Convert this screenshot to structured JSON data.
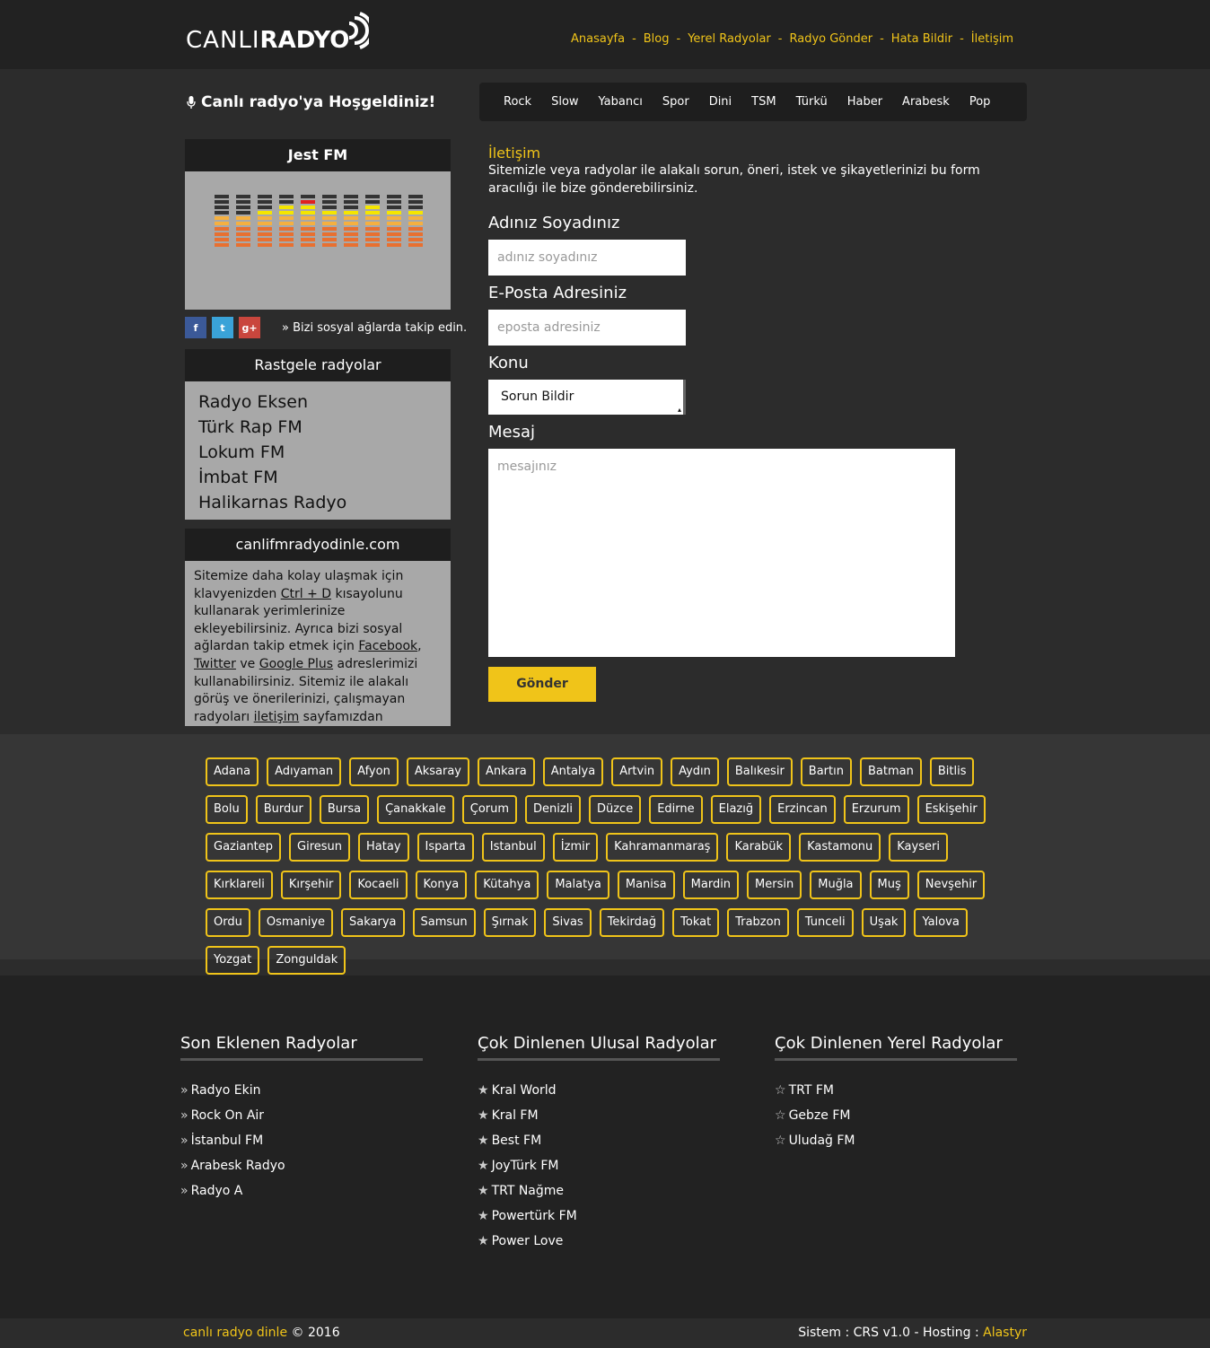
{
  "logo": {
    "part1": "CANLI",
    "part2": "RADYO"
  },
  "nav": [
    "Anasayfa",
    "Blog",
    "Yerel Radyolar",
    "Radyo Gönder",
    "Hata Bildir",
    "İletişim"
  ],
  "welcome": "Canlı radyo'ya Hoşgeldiniz!",
  "genres": [
    "Rock",
    "Slow",
    "Yabancı",
    "Spor",
    "Dini",
    "TSM",
    "Türkü",
    "Haber",
    "Arabesk",
    "Pop"
  ],
  "player": {
    "title": "Jest FM",
    "levels": [
      0.55,
      0.55,
      0.65,
      0.75,
      0.9,
      0.65,
      0.65,
      0.8,
      0.65,
      0.65
    ]
  },
  "social": {
    "facebook": "f",
    "twitter": "t",
    "gplus": "g+",
    "text": "Bizi sosyal ağlarda takip edin."
  },
  "random": {
    "title": "Rastgele radyolar",
    "items": [
      "Radyo Eksen",
      "Türk Rap FM",
      "Lokum FM",
      "İmbat FM",
      "Halikarnas Radyo"
    ]
  },
  "info": {
    "title": "canlifmradyodinle.com",
    "t1": "Sitemize daha kolay ulaşmak için klavyenizden ",
    "k1": "Ctrl + D",
    "t2": " kısayolunu kullanarak yerimlerinize ekleyebilirsiniz. Ayrıca bizi sosyal ağlardan takip etmek için ",
    "l1": "Facebook",
    "t3": ", ",
    "l2": "Twitter",
    "t4": " ve ",
    "l3": "Google Plus",
    "t5": " adreslerimizi kullanabilirsiniz. Sitemiz ile alakalı görüş ve önerilerinizi, çalışmayan radyoları ",
    "l4": "iletişim",
    "t6": " sayfamızdan iletebilirsiniz."
  },
  "form": {
    "title": "İletişim",
    "desc": "Sitemizle veya radyolar ile alakalı sorun, öneri, istek ve şikayetlerinizi bu form aracılığı ile bize gönderebilirsiniz.",
    "name_label": "Adınız Soyadınız",
    "name_placeholder": "adınız soyadınız",
    "email_label": "E-Posta Adresiniz",
    "email_placeholder": "eposta adresiniz",
    "subject_label": "Konu",
    "subject_value": "Sorun Bildir",
    "message_label": "Mesaj",
    "message_placeholder": "mesajınız",
    "submit": "Gönder"
  },
  "cities": [
    "Adana",
    "Adıyaman",
    "Afyon",
    "Aksaray",
    "Ankara",
    "Antalya",
    "Artvin",
    "Aydın",
    "Balıkesir",
    "Bartın",
    "Batman",
    "Bitlis",
    "Bolu",
    "Burdur",
    "Bursa",
    "Çanakkale",
    "Çorum",
    "Denizli",
    "Düzce",
    "Edirne",
    "Elazığ",
    "Erzincan",
    "Erzurum",
    "Eskişehir",
    "Gaziantep",
    "Giresun",
    "Hatay",
    "Isparta",
    "Istanbul",
    "İzmir",
    "Kahramanmaraş",
    "Karabük",
    "Kastamonu",
    "Kayseri",
    "Kırklareli",
    "Kırşehir",
    "Kocaeli",
    "Konya",
    "Kütahya",
    "Malatya",
    "Manisa",
    "Mardin",
    "Mersin",
    "Muğla",
    "Muş",
    "Nevşehir",
    "Ordu",
    "Osmaniye",
    "Sakarya",
    "Samsun",
    "Şırnak",
    "Sivas",
    "Tekirdağ",
    "Tokat",
    "Trabzon",
    "Tunceli",
    "Uşak",
    "Yalova",
    "Yozgat",
    "Zonguldak"
  ],
  "footer": {
    "col1": {
      "title": "Son Eklenen Radyolar",
      "items": [
        "Radyo Ekin",
        "Rock On Air",
        "İstanbul FM",
        "Arabesk Radyo",
        "Radyo A"
      ]
    },
    "col2": {
      "title": "Çok Dinlenen Ulusal Radyolar",
      "items": [
        "Kral World",
        "Kral FM",
        "Best FM",
        "JoyTürk FM",
        "TRT Nağme",
        "Powertürk FM",
        "Power Love"
      ]
    },
    "col3": {
      "title": "Çok Dinlenen Yerel Radyolar",
      "items": [
        "TRT FM",
        "Gebze FM",
        "Uludağ FM"
      ]
    }
  },
  "bottom": {
    "site": "canlı radyo dinle",
    "copy": "© 2016",
    "system": "Sistem : CRS v1.0 - Hosting : ",
    "host": "Alastyr"
  }
}
